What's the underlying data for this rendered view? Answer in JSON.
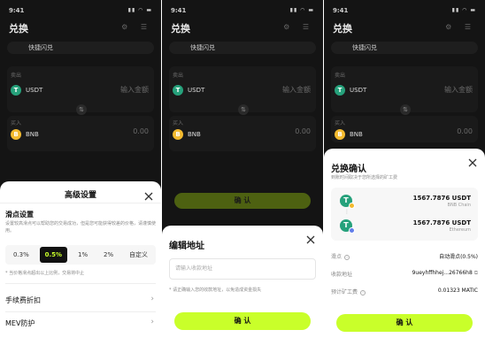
{
  "status_time": "9:41",
  "background": {
    "title": "兑换",
    "tab": "快捷闪兑",
    "from_label": "卖出",
    "from_token": "USDT",
    "from_placeholder": "输入金额",
    "to_label": "买入",
    "to_token": "BNB",
    "to_value": "0.00",
    "confirm": "确 认",
    "colors": {
      "usdt": "#26a17b",
      "bnb": "#f3ba2f"
    }
  },
  "settings_sheet": {
    "title": "高级设置",
    "slippage_title": "滑点设置",
    "slippage_desc": "设置较高滑点可以帮助您的交易成功，但是您可能获得较差的价格，请谨慎使用。",
    "options": [
      "0.3%",
      "0.5%",
      "1%",
      "2%",
      "自定义"
    ],
    "selected_option": "0.5%",
    "note": "* 当价格滑点超出以上比例，交易将中止",
    "menu": [
      {
        "label": "手续费折扣"
      },
      {
        "label": "MEV防护"
      }
    ]
  },
  "address_sheet": {
    "title": "编辑地址",
    "input_placeholder": "请输入收款地址",
    "note": "* 请正确输入您的收款地址，以免造成资金损失",
    "confirm": "确 认"
  },
  "confirm_sheet": {
    "title": "兑换确认",
    "subtitle": "到账时间取决于您所选择的矿工费",
    "from": {
      "amount": "1567.7876 USDT",
      "chain": "BNB Chain",
      "badge_color": "#f3ba2f"
    },
    "to": {
      "amount": "1567.7876 USDT",
      "chain": "Ethereum",
      "badge_color": "#627eea"
    },
    "rows": [
      {
        "key": "滑点",
        "value": "自动滑点(0.5%)"
      },
      {
        "key": "收款地址",
        "value": "9ueyhffhhej...26766h8"
      },
      {
        "key": "预计矿工费",
        "value": "0.01323 MATIC"
      }
    ],
    "confirm": "确 认"
  }
}
